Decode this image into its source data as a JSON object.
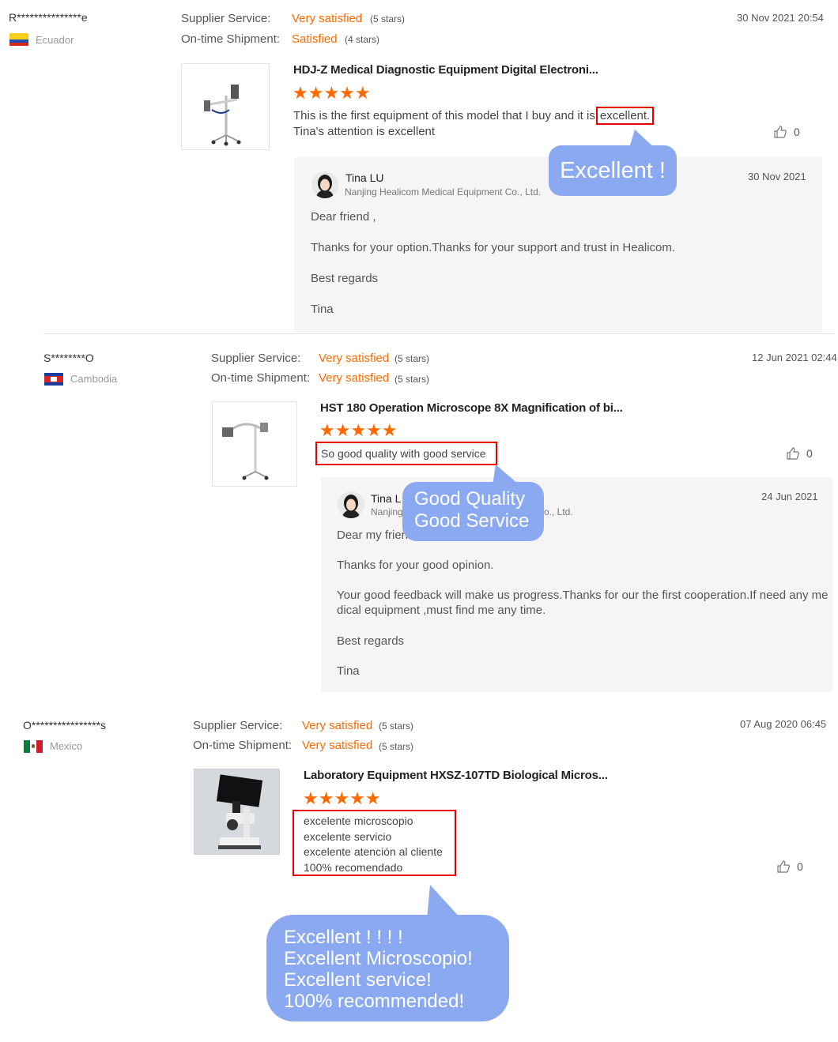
{
  "labels": {
    "supplier_service": "Supplier Service:",
    "ontime_shipment": "On-time Shipment:"
  },
  "colors": {
    "accent": "#ff6a00",
    "highlight": "#e60000",
    "bubble": "#8aa9f0",
    "reply_bg": "#f5f5f5"
  },
  "reviews": [
    {
      "buyer": "R***************e",
      "country": "Ecuador",
      "flag_icon": "ecuador-flag-icon",
      "supplier_rating": "Very satisfied",
      "supplier_stars": "(5 stars)",
      "shipment_rating": "Satisfied",
      "shipment_stars": "(4 stars)",
      "date": "30 Nov 2021 20:54",
      "product_title": "HDJ-Z Medical Diagnostic Equipment Digital Electroni...",
      "stars": "★★★★★",
      "stars_value": 5,
      "text_line1_prefix": "This is the first equipment of this model that I buy and it is",
      "text_line1_highlight": "excellent.",
      "text_line2": "Tina's attention is excellent",
      "likes": "0",
      "reply": {
        "name": "Tina LU",
        "company": "Nanjing Healicom Medical Equipment Co., Ltd.",
        "date": "30 Nov 2021",
        "lines": [
          "Dear friend ,",
          "Thanks for your option.Thanks for your support and trust in Healicom.",
          "Best regards",
          "Tina"
        ]
      },
      "bubble": "Excellent !"
    },
    {
      "buyer": "S********O",
      "country": "Cambodia",
      "flag_icon": "cambodia-flag-icon",
      "supplier_rating": "Very satisfied",
      "supplier_stars": "(5 stars)",
      "shipment_rating": "Very satisfied",
      "shipment_stars": "(5 stars)",
      "date": "12 Jun 2021 02:44",
      "product_title": "HST 180 Operation Microscope 8X Magnification of bi...",
      "stars": "★★★★★",
      "stars_value": 5,
      "text": "So good quality with good service",
      "likes": "0",
      "reply": {
        "name": "Tina L",
        "company": "Nanjing",
        "company_tail": "o., Ltd.",
        "date": "24 Jun 2021",
        "lines": [
          "Dear my friend,",
          "Thanks for your good opinion.",
          "Your good feedback will make us progress.Thanks for our the first cooperation.If need any me",
          "dical equipment ,must find me any time.",
          "Best regards",
          "Tina"
        ]
      },
      "bubble_line1": "Good Quality",
      "bubble_line2": "Good Service"
    },
    {
      "buyer": "O****************s",
      "country": "Mexico",
      "flag_icon": "mexico-flag-icon",
      "supplier_rating": "Very satisfied",
      "supplier_stars": "(5 stars)",
      "shipment_rating": "Very satisfied",
      "shipment_stars": "(5 stars)",
      "date": "07 Aug 2020 06:45",
      "product_title": "Laboratory Equipment HXSZ-107TD Biological Micros...",
      "stars": "★★★★★",
      "stars_value": 5,
      "text_lines": [
        "excelente microscopio",
        "excelente servicio",
        "excelente atención al cliente",
        "100% recomendado"
      ],
      "likes": "0",
      "bubble_lines": [
        "Excellent ! ! ! !",
        "Excellent Microscopio!",
        "Excellent service!",
        "100% recommended!"
      ]
    }
  ]
}
